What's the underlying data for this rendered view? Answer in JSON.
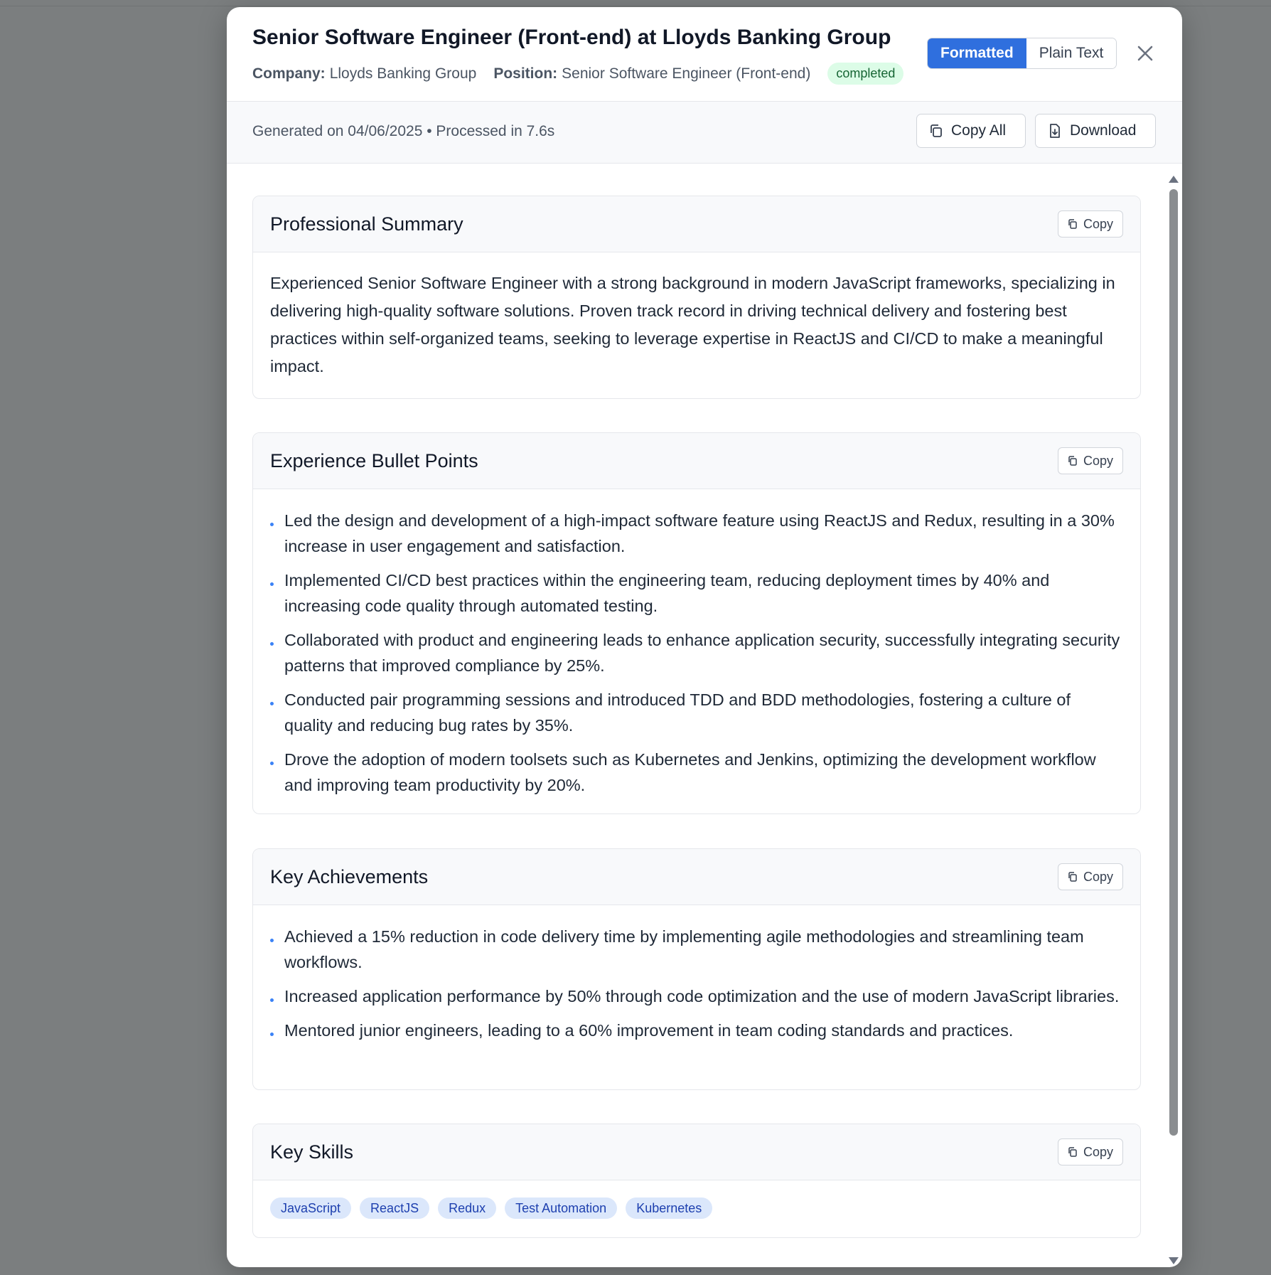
{
  "header": {
    "title": "Senior Software Engineer (Front-end) at Lloyds Banking Group",
    "company_label": "Company:",
    "company_value": "Lloyds Banking Group",
    "position_label": "Position:",
    "position_value": "Senior Software Engineer (Front-end)",
    "status": "completed",
    "view_modes": [
      "Formatted",
      "Plain Text"
    ],
    "active_view_mode": "Formatted"
  },
  "subbar": {
    "generated_text": "Generated on 04/06/2025 • Processed in 7.6s",
    "copy_all_label": "Copy All",
    "download_label": "Download"
  },
  "copy_label": "Copy",
  "sections": {
    "summary": {
      "title": "Professional Summary",
      "text": "Experienced Senior Software Engineer with a strong background in modern JavaScript frameworks, specializing in delivering high-quality software solutions. Proven track record in driving technical delivery and fostering best practices within self-organized teams, seeking to leverage expertise in ReactJS and CI/CD to make a meaningful impact."
    },
    "experience": {
      "title": "Experience Bullet Points",
      "items": [
        "Led the design and development of a high-impact software feature using ReactJS and Redux, resulting in a 30% increase in user engagement and satisfaction.",
        "Implemented CI/CD best practices within the engineering team, reducing deployment times by 40% and increasing code quality through automated testing.",
        "Collaborated with product and engineering leads to enhance application security, successfully integrating security patterns that improved compliance by 25%.",
        "Conducted pair programming sessions and introduced TDD and BDD methodologies, fostering a culture of quality and reducing bug rates by 35%.",
        "Drove the adoption of modern toolsets such as Kubernetes and Jenkins, optimizing the development workflow and improving team productivity by 20%."
      ]
    },
    "achievements": {
      "title": "Key Achievements",
      "items": [
        "Achieved a 15% reduction in code delivery time by implementing agile methodologies and streamlining team workflows.",
        "Increased application performance by 50% through code optimization and the use of modern JavaScript libraries.",
        "Mentored junior engineers, leading to a 60% improvement in team coding standards and practices."
      ]
    },
    "skills": {
      "title": "Key Skills",
      "items": [
        "JavaScript",
        "ReactJS",
        "Redux",
        "Test Automation",
        "Kubernetes"
      ]
    }
  },
  "colors": {
    "accent": "#2f6fde",
    "status_bg": "#dcfce7",
    "status_text": "#166534",
    "tag_bg": "#dbe7fb",
    "tag_text": "#1e40af"
  }
}
